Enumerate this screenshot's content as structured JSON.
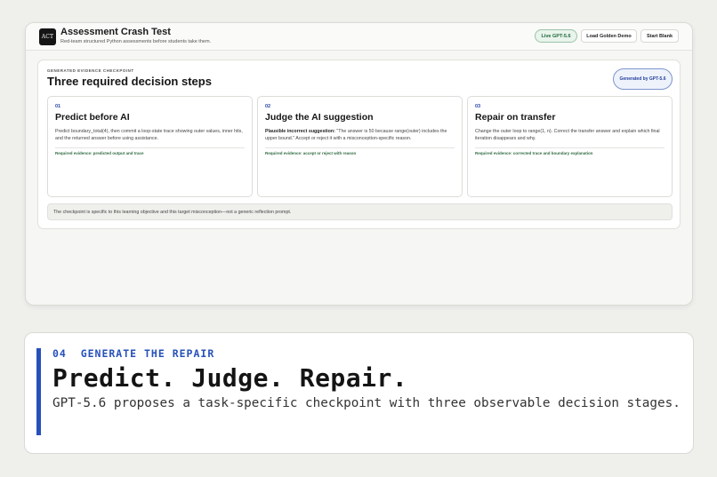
{
  "header": {
    "logo_text": "ACT",
    "title": "Assessment Crash Test",
    "subtitle": "Red-team structured Python assessments before students take them.",
    "buttons": {
      "live": "Live GPT-5.6",
      "golden": "Load Golden Demo",
      "blank": "Start Blank"
    }
  },
  "panel": {
    "eyebrow": "GENERATED EVIDENCE CHECKPOINT",
    "title": "Three required decision steps",
    "badge": "Generated by GPT-5.6",
    "steps": [
      {
        "num": "01",
        "title": "Predict before AI",
        "body": "Predict boundary_total(4), then commit a loop-state trace showing outer values, inner hits, and the returned answer before using assistance.",
        "evidence": "Required evidence: predicted output and trace"
      },
      {
        "num": "02",
        "title": "Judge the AI suggestion",
        "body_lead": "Plausible incorrect suggestion:",
        "body": " \"The answer is 50 because range(outer) includes the upper bound.\" Accept or reject it with a misconception-specific reason.",
        "evidence": "Required evidence: accept or reject with reason"
      },
      {
        "num": "03",
        "title": "Repair on transfer",
        "body": "Change the outer loop to range(1, n). Correct the transfer answer and explain which final iteration disappears and why.",
        "evidence": "Required evidence: corrected trace and boundary explanation"
      }
    ],
    "note": "The checkpoint is specific to this learning objective and this target misconception—not a generic reflection prompt."
  },
  "hero": {
    "eyebrow": "04  GENERATE THE REPAIR",
    "title": "Predict. Judge. Repair.",
    "subtitle": "GPT-5.6 proposes a task-specific checkpoint with three observable decision stages."
  },
  "colors": {
    "accent_blue": "#2750ba",
    "live_green": "#1f6a3a",
    "evidence_green": "#2f6b40"
  }
}
